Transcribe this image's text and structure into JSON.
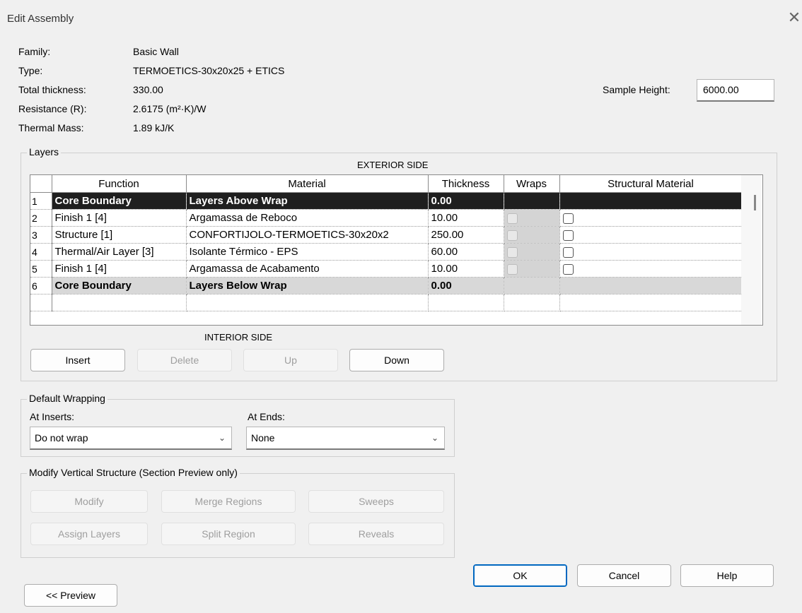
{
  "window": {
    "title": "Edit Assembly",
    "close_glyph": "✕"
  },
  "properties": [
    {
      "label": "Family:",
      "value": "Basic Wall"
    },
    {
      "label": "Type:",
      "value": "TERMOETICS-30x20x25 + ETICS"
    },
    {
      "label": "Total thickness:",
      "value": "330.00"
    },
    {
      "label": "Resistance (R):",
      "value": "2.6175 (m²·K)/W"
    },
    {
      "label": "Thermal Mass:",
      "value": "1.89 kJ/K"
    }
  ],
  "sample_height": {
    "label": "Sample Height:",
    "value": "6000.00"
  },
  "layers": {
    "group_label": "Layers",
    "exterior_label": "EXTERIOR SIDE",
    "interior_label": "INTERIOR SIDE",
    "columns": [
      "Function",
      "Material",
      "Thickness",
      "Wraps",
      "Structural Material"
    ],
    "rows": [
      {
        "num": "1",
        "function": "Core Boundary",
        "material": "Layers Above Wrap",
        "thickness": "0.00"
      },
      {
        "num": "2",
        "function": "Finish 1 [4]",
        "material": "Argamassa de Reboco",
        "thickness": "10.00"
      },
      {
        "num": "3",
        "function": "Structure [1]",
        "material": "CONFORTIJOLO-TERMOETICS-30x20x2",
        "thickness": "250.00"
      },
      {
        "num": "4",
        "function": "Thermal/Air Layer [3]",
        "material": "Isolante Térmico - EPS",
        "thickness": "60.00"
      },
      {
        "num": "5",
        "function": "Finish 1 [4]",
        "material": "Argamassa de Acabamento",
        "thickness": "10.00"
      },
      {
        "num": "6",
        "function": "Core Boundary",
        "material": "Layers Below Wrap",
        "thickness": "0.00"
      }
    ],
    "buttons": {
      "insert": "Insert",
      "delete": "Delete",
      "up": "Up",
      "down": "Down"
    }
  },
  "default_wrapping": {
    "group_label": "Default Wrapping",
    "at_inserts_label": "At Inserts:",
    "at_inserts_value": "Do not wrap",
    "at_ends_label": "At Ends:",
    "at_ends_value": "None"
  },
  "modify_vertical": {
    "group_label": "Modify Vertical Structure (Section Preview only)",
    "buttons": {
      "modify": "Modify",
      "merge_regions": "Merge Regions",
      "sweeps": "Sweeps",
      "assign_layers": "Assign Layers",
      "split_region": "Split Region",
      "reveals": "Reveals"
    }
  },
  "footer": {
    "ok": "OK",
    "cancel": "Cancel",
    "help": "Help",
    "preview": "<< Preview"
  },
  "colors": {
    "selected_row": "#1f1f1f",
    "core_row": "#d8d8d8",
    "primary_border": "#0067c0"
  }
}
